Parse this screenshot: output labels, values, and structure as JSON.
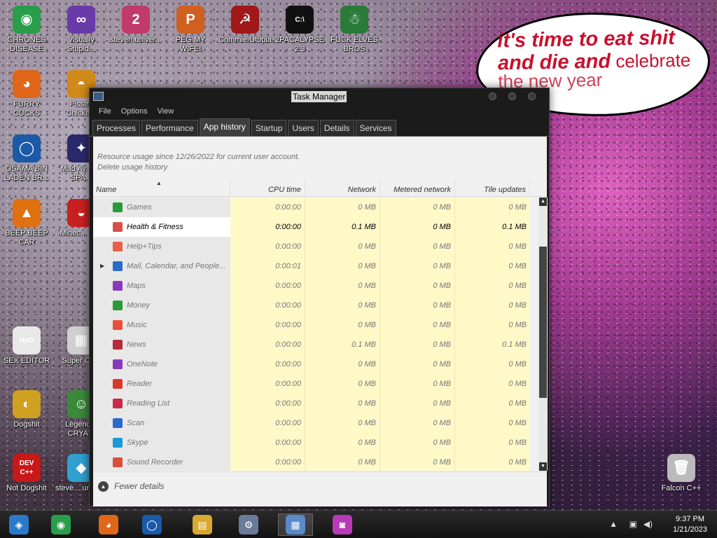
{
  "desktop": {
    "icons": [
      {
        "label": "CHRONES DISEASE",
        "icon": "chrome-icon",
        "color": "#2a9d4a",
        "glyph": "◉"
      },
      {
        "label": "Visually Stupid...",
        "icon": "visual-studio-icon",
        "color": "#6a3aa8",
        "glyph": "∞"
      },
      {
        "label": "steven univer...",
        "icon": "steven-universe-icon",
        "color": "#c03a6a",
        "glyph": "2"
      },
      {
        "label": "PEG MY WIFE!",
        "icon": "peggle-icon",
        "color": "#d06020",
        "glyph": "P"
      },
      {
        "label": "Commie Utopia",
        "icon": "commie-bird-icon",
        "color": "#a01818",
        "glyph": "☭"
      },
      {
        "label": "2PACALYPSE 2.3",
        "icon": "cmd-icon",
        "color": "#111111",
        "glyph": "C:\\"
      },
      {
        "label": "FUCK ELVES BROS",
        "icon": "santa-icon",
        "color": "#2a7a3a",
        "glyph": "☃"
      },
      {
        "label": "FURRY CUCKS",
        "icon": "firefox-icon",
        "color": "#e0661a",
        "glyph": "◕"
      },
      {
        "label": "Pissed Chicke...",
        "icon": "angry-bird-icon",
        "color": "#d08a1a",
        "glyph": "◓"
      },
      {
        "label": "OSAMA BIN LADEN BR...",
        "icon": "obama-logo-icon",
        "color": "#1a5aa8",
        "glyph": "◯"
      },
      {
        "label": "Mad Av... IN SPA...",
        "icon": "angry-birds-space-icon",
        "color": "#2a2a6a",
        "glyph": "✦"
      },
      {
        "label": "BEEP BEEP CAR",
        "icon": "vlc-cone-icon",
        "color": "#e07010",
        "glyph": "▲"
      },
      {
        "label": "Minec... Bird",
        "icon": "angry-bird-red-icon",
        "color": "#c82020",
        "glyph": "◒"
      },
      {
        "label": "SEX EDITOR",
        "icon": "hxd-editor-icon",
        "color": "#e8e8e8",
        "glyph": "HxD"
      },
      {
        "label": "Super CF...",
        "icon": "pixel-game-icon",
        "color": "#cfcfcf",
        "glyph": "▦"
      },
      {
        "label": "Dogshit",
        "icon": "dog-icon",
        "color": "#d0a020",
        "glyph": "◐"
      },
      {
        "label": "Legend... CRYA...",
        "icon": "zelda-icon",
        "color": "#3a8a3a",
        "glyph": "☺"
      },
      {
        "label": "Not Dogshit",
        "icon": "dev-cpp-icon",
        "color": "#c81818",
        "glyph": "DEV C++"
      },
      {
        "label": "steve... unive...",
        "icon": "diamond-icon",
        "color": "#30a0d0",
        "glyph": "◆"
      },
      {
        "label": "Falcon C++",
        "icon": "recycle-bin-icon",
        "color": "#bbbbbb",
        "glyph": "🗑"
      }
    ],
    "speech_bubble": {
      "line1": "it's time to eat shit",
      "line2a": "and die and",
      "line2b": " celebrate",
      "line3": "the new year"
    }
  },
  "task_manager": {
    "title": "Task Manager",
    "menu": [
      "File",
      "Options",
      "View"
    ],
    "tabs": [
      "Processes",
      "Performance",
      "App history",
      "Startup",
      "Users",
      "Details",
      "Services"
    ],
    "active_tab": "App history",
    "info_line1": "Resource usage since 12/26/2022 for current user account.",
    "info_line2": "Delete usage history",
    "columns": {
      "name": "Name",
      "cpu": "CPU time",
      "network": "Network",
      "metered": "Metered network",
      "tile": "Tile updates"
    },
    "rows": [
      {
        "name": "Games",
        "cpu": "0:00:00",
        "network": "0 MB",
        "metered": "0 MB",
        "tile": "0 MB",
        "icon": "games-icon",
        "color": "#2a9a3a"
      },
      {
        "name": "Health & Fitness",
        "cpu": "0:00:00",
        "network": "0.1 MB",
        "metered": "0 MB",
        "tile": "0.1 MB",
        "icon": "health-fitness-icon",
        "color": "#d8504a",
        "selected": true
      },
      {
        "name": "Help+Tips",
        "cpu": "0:00:00",
        "network": "0 MB",
        "metered": "0 MB",
        "tile": "0 MB",
        "icon": "help-tips-icon",
        "color": "#e8604a"
      },
      {
        "name": "Mail, Calendar, and People...",
        "cpu": "0:00:01",
        "network": "0 MB",
        "metered": "0 MB",
        "tile": "0 MB",
        "icon": "mail-icon",
        "color": "#2a6ac8",
        "expandable": true
      },
      {
        "name": "Maps",
        "cpu": "0:00:00",
        "network": "0 MB",
        "metered": "0 MB",
        "tile": "0 MB",
        "icon": "maps-icon",
        "color": "#8a3ab8"
      },
      {
        "name": "Money",
        "cpu": "0:00:00",
        "network": "0 MB",
        "metered": "0 MB",
        "tile": "0 MB",
        "icon": "money-icon",
        "color": "#2a9a3a"
      },
      {
        "name": "Music",
        "cpu": "0:00:00",
        "network": "0 MB",
        "metered": "0 MB",
        "tile": "0 MB",
        "icon": "music-icon",
        "color": "#e8503a"
      },
      {
        "name": "News",
        "cpu": "0:00:00",
        "network": "0.1 MB",
        "metered": "0 MB",
        "tile": "0.1 MB",
        "icon": "news-icon",
        "color": "#b82a3a"
      },
      {
        "name": "OneNote",
        "cpu": "0:00:00",
        "network": "0 MB",
        "metered": "0 MB",
        "tile": "0 MB",
        "icon": "onenote-icon",
        "color": "#8a3ab8"
      },
      {
        "name": "Reader",
        "cpu": "0:00:00",
        "network": "0 MB",
        "metered": "0 MB",
        "tile": "0 MB",
        "icon": "reader-icon",
        "color": "#d83a2a"
      },
      {
        "name": "Reading List",
        "cpu": "0:00:00",
        "network": "0 MB",
        "metered": "0 MB",
        "tile": "0 MB",
        "icon": "reading-list-icon",
        "color": "#c82a4a"
      },
      {
        "name": "Scan",
        "cpu": "0:00:00",
        "network": "0 MB",
        "metered": "0 MB",
        "tile": "0 MB",
        "icon": "scan-icon",
        "color": "#2a6ac8"
      },
      {
        "name": "Skype",
        "cpu": "0:00:00",
        "network": "0 MB",
        "metered": "0 MB",
        "tile": "0 MB",
        "icon": "skype-icon",
        "color": "#1a9ad8"
      },
      {
        "name": "Sound Recorder",
        "cpu": "0:00:00",
        "network": "0 MB",
        "metered": "0 MB",
        "tile": "0 MB",
        "icon": "sound-recorder-icon",
        "color": "#d8503a"
      }
    ],
    "footer_label": "Fewer details"
  },
  "taskbar": {
    "items": [
      {
        "icon": "start-icon",
        "color": "#2a7ac8",
        "glyph": "◈"
      },
      {
        "icon": "chrome-icon",
        "color": "#2a9d4a",
        "glyph": "◉"
      },
      {
        "icon": "firefox-icon",
        "color": "#e0661a",
        "glyph": "◕"
      },
      {
        "icon": "obama-logo-icon",
        "color": "#1a5aa8",
        "glyph": "◯"
      },
      {
        "icon": "file-explorer-icon",
        "color": "#d8a830",
        "glyph": "▤"
      },
      {
        "icon": "installer-icon",
        "color": "#6a7a9a",
        "glyph": "⚙"
      },
      {
        "icon": "task-manager-icon",
        "color": "#5a8ac8",
        "glyph": "▦",
        "active": true
      },
      {
        "icon": "camera-app-icon",
        "color": "#b83ab8",
        "glyph": "◙"
      }
    ],
    "time": "9:37 PM",
    "date": "1/21/2023"
  }
}
